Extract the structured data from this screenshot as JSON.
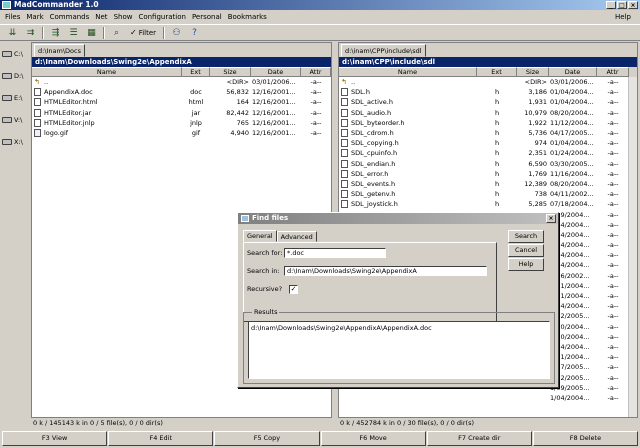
{
  "window": {
    "title": "MadCommander 1.0",
    "controls": [
      "_",
      "□",
      "×"
    ]
  },
  "menu": {
    "items": [
      "Files",
      "Mark",
      "Commands",
      "Net",
      "Show",
      "Configuration",
      "Personal",
      "Bookmarks"
    ],
    "help": "Help"
  },
  "toolbar": {
    "filter_label": "Filter"
  },
  "drives": [
    "C:\\",
    "D:\\",
    "E:\\",
    "V:\\",
    "X:\\"
  ],
  "left_panel": {
    "tab": "d:\\Inam\\Docs",
    "path": "d:\\Inam\\Downloads\\Swing2e\\AppendixA",
    "columns": [
      "Name",
      "Ext",
      "Size",
      "Date",
      "Attr"
    ],
    "rows": [
      {
        "icon": "up",
        "name": "..",
        "ext": "",
        "size": "<DIR>",
        "date": "03/01/2006...",
        "attr": "-a--"
      },
      {
        "icon": "doc",
        "name": "AppendixA.doc",
        "ext": "doc",
        "size": "56,832",
        "date": "12/16/2001...",
        "attr": "-a--"
      },
      {
        "icon": "html",
        "name": "HTMLEditor.html",
        "ext": "html",
        "size": "164",
        "date": "12/16/2001...",
        "attr": "-a--"
      },
      {
        "icon": "jar",
        "name": "HTMLEditor.jar",
        "ext": "jar",
        "size": "82,442",
        "date": "12/16/2001...",
        "attr": "-a--"
      },
      {
        "icon": "jnlp",
        "name": "HTMLEditor.jnlp",
        "ext": "jnlp",
        "size": "765",
        "date": "12/16/2001...",
        "attr": "-a--"
      },
      {
        "icon": "gif",
        "name": "logo.gif",
        "ext": "gif",
        "size": "4,940",
        "date": "12/16/2001...",
        "attr": "-a--"
      }
    ],
    "status": "0 k / 145143 k in 0 / 5 file(s), 0 / 0 dir(s)"
  },
  "right_panel": {
    "tab": "d:\\inam\\CPP\\include\\sdl",
    "path": "d:\\inam\\CPP\\include\\sdl",
    "columns": [
      "Name",
      "Ext",
      "Size",
      "Date",
      "Attr"
    ],
    "rows": [
      {
        "name": "..",
        "ext": "",
        "size": "<DIR>",
        "date": "03/01/2006...",
        "attr": "-a--"
      },
      {
        "name": "SDL.h",
        "ext": "h",
        "size": "3,186",
        "date": "01/04/2004...",
        "attr": "-a--"
      },
      {
        "name": "SDL_active.h",
        "ext": "h",
        "size": "1,931",
        "date": "01/04/2004...",
        "attr": "-a--"
      },
      {
        "name": "SDL_audio.h",
        "ext": "h",
        "size": "10,979",
        "date": "08/20/2004...",
        "attr": "-a--"
      },
      {
        "name": "SDL_byteorder.h",
        "ext": "h",
        "size": "1,922",
        "date": "11/12/2004...",
        "attr": "-a--"
      },
      {
        "name": "SDL_cdrom.h",
        "ext": "h",
        "size": "5,736",
        "date": "04/17/2005...",
        "attr": "-a--"
      },
      {
        "name": "SDL_copying.h",
        "ext": "h",
        "size": "974",
        "date": "01/04/2004...",
        "attr": "-a--"
      },
      {
        "name": "SDL_cpuinfo.h",
        "ext": "h",
        "size": "2,351",
        "date": "01/24/2004...",
        "attr": "-a--"
      },
      {
        "name": "SDL_endian.h",
        "ext": "h",
        "size": "6,590",
        "date": "03/30/2005...",
        "attr": "-a--"
      },
      {
        "name": "SDL_error.h",
        "ext": "h",
        "size": "1,769",
        "date": "11/16/2004...",
        "attr": "-a--"
      },
      {
        "name": "SDL_events.h",
        "ext": "h",
        "size": "12,389",
        "date": "08/20/2004...",
        "attr": "-a--"
      },
      {
        "name": "SDL_getenv.h",
        "ext": "h",
        "size": "738",
        "date": "04/11/2002...",
        "attr": "-a--"
      },
      {
        "name": "SDL_joystick.h",
        "ext": "h",
        "size": "5,285",
        "date": "07/18/2004...",
        "attr": "-a--"
      },
      {
        "name": "",
        "ext": "",
        "size": "",
        "date": "7/19/2004...",
        "attr": "-a--"
      },
      {
        "name": "",
        "ext": "",
        "size": "",
        "date": "1/04/2004...",
        "attr": "-a--"
      },
      {
        "name": "",
        "ext": "",
        "size": "",
        "date": "1/04/2004...",
        "attr": "-a--"
      },
      {
        "name": "",
        "ext": "",
        "size": "",
        "date": "1/04/2004...",
        "attr": "-a--"
      },
      {
        "name": "",
        "ext": "",
        "size": "",
        "date": "1/04/2004...",
        "attr": "-a--"
      },
      {
        "name": "",
        "ext": "",
        "size": "",
        "date": "1/04/2004...",
        "attr": "-a--"
      },
      {
        "name": "",
        "ext": "",
        "size": "",
        "date": "3/06/2002...",
        "attr": "-a--"
      },
      {
        "name": "",
        "ext": "",
        "size": "",
        "date": "6/21/2004...",
        "attr": "-a--"
      },
      {
        "name": "",
        "ext": "",
        "size": "",
        "date": "3/21/2004...",
        "attr": "-a--"
      },
      {
        "name": "",
        "ext": "",
        "size": "",
        "date": "1/04/2004...",
        "attr": "-a--"
      },
      {
        "name": "",
        "ext": "",
        "size": "",
        "date": "2/12/2005...",
        "attr": "-a--"
      },
      {
        "name": "",
        "ext": "",
        "size": "",
        "date": "3/20/2004...",
        "attr": "-a--"
      },
      {
        "name": "",
        "ext": "",
        "size": "",
        "date": "3/20/2004...",
        "attr": "-a--"
      },
      {
        "name": "",
        "ext": "",
        "size": "",
        "date": "1/04/2004...",
        "attr": "-a--"
      },
      {
        "name": "",
        "ext": "",
        "size": "",
        "date": "7/21/2004...",
        "attr": "-a--"
      },
      {
        "name": "",
        "ext": "",
        "size": "",
        "date": "4/17/2005...",
        "attr": "-a--"
      },
      {
        "name": "",
        "ext": "",
        "size": "",
        "date": "1/02/2005...",
        "attr": "-a--"
      },
      {
        "name": "",
        "ext": "",
        "size": "",
        "date": "1/09/2005...",
        "attr": "-a--"
      },
      {
        "name": "",
        "ext": "",
        "size": "",
        "date": "1/04/2004...",
        "attr": "-a--"
      }
    ],
    "status": "0 k / 452784 k in 0 / 30 file(s), 0 / 0 dir(s)"
  },
  "find_dialog": {
    "title": "Find files",
    "tabs": [
      "General",
      "Advanced"
    ],
    "search_for_label": "Search for:",
    "search_for_value": "*.doc",
    "search_in_label": "Search in:",
    "search_in_value": "d:\\Inam\\Downloads\\Swing2e\\AppendixA",
    "recursive_label": "Recursive?",
    "recursive_checked": "✓",
    "buttons": {
      "search": "Search",
      "cancel": "Cancel",
      "help": "Help"
    },
    "results_label": "Results",
    "results": [
      "d:\\Inam\\Downloads\\Swing2e\\AppendixA\\AppendixA.doc"
    ]
  },
  "function_keys": [
    "F3 View",
    "F4 Edit",
    "F5 Copy",
    "F6 Move",
    "F7 Create dir",
    "F8 Delete"
  ]
}
